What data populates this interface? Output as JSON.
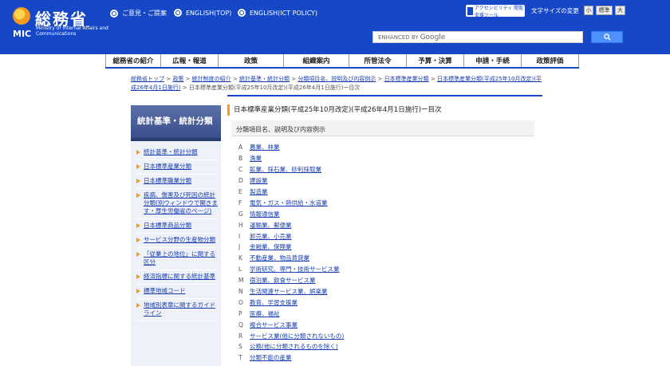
{
  "header": {
    "logo_jp": "総務省",
    "logo_mic": "MIC",
    "logo_en": "Ministry of Internal Affairs and Communications",
    "links": [
      "ご意見・ご提案",
      "ENGLISH(TOP)",
      "ENGLISH(ICT POLICY)"
    ],
    "accessibility": "アクセシビリティ 閲覧支援ツール",
    "font_size_label": "文字サイズの変更",
    "font_size_options": [
      "小",
      "標準",
      "大"
    ],
    "search_prefix": "ENHANCED BY",
    "search_brand": "Google",
    "search_icon": "search-icon"
  },
  "nav": [
    "総務省の紹介",
    "広報・報道",
    "政策",
    "組織案内",
    "所管法令",
    "予算・決算",
    "申請・手続",
    "政策評価"
  ],
  "breadcrumb": {
    "items": [
      "総務省トップ",
      "政策",
      "統計制度の紹介",
      "統計基準・統計分類",
      "分類項目名、説明及び内容例示",
      "日本標準産業分類",
      "日本標準産業分類(平成25年10月改定)(平成26年4月1日施行)"
    ],
    "current": "日本標準産業分類(平成25年10月改定)(平成26年4月1日施行)ー目次"
  },
  "sidebar": {
    "title": "統計基準・統計分類",
    "items": [
      "統計基準・統計分類",
      "日本標準産業分類",
      "日本標準職業分類",
      "疾病、傷害及び死因の統計分類(別ウィンドウで開きます・厚生労働省のページ)",
      "日本標準商品分類",
      "サービス分野の生産物分類",
      "「従業上の地位」に関する区分",
      "経済指標に関する統計基準",
      "標準地域コード",
      "地域別表章に関するガイドライン"
    ]
  },
  "main": {
    "title": "日本標準産業分類(平成25年10月改定)(平成26年4月1日施行)ー目次",
    "subheading": "分類項目名、説明及び内容例示",
    "classes": [
      {
        "code": "A",
        "name": "農業、林業",
        "link": true
      },
      {
        "code": "B",
        "name": "漁業",
        "link": true
      },
      {
        "code": "C",
        "name": "鉱業、採石業、砂利採取業",
        "link": true
      },
      {
        "code": "D",
        "name": "建設業",
        "link": true
      },
      {
        "code": "E",
        "name": "製造業",
        "link": true
      },
      {
        "code": "F",
        "name": "電気・ガス・熱供給・水道業",
        "link": true
      },
      {
        "code": "G",
        "name": "情報通信業",
        "link": true
      },
      {
        "code": "H",
        "name": "運輸業、郵便業",
        "link": true
      },
      {
        "code": "I",
        "name": "卸売業、小売業",
        "link": true
      },
      {
        "code": "J",
        "name": "金融業、保険業",
        "link": true
      },
      {
        "code": "K",
        "name": "不動産業、物品賃貸業",
        "link": true
      },
      {
        "code": "L",
        "name": "学術研究、専門・技術サービス業",
        "link": true
      },
      {
        "code": "M",
        "name": "宿泊業、飲食サービス業",
        "link": true
      },
      {
        "code": "N",
        "name": "生活関連サービス業、娯楽業",
        "link": true
      },
      {
        "code": "O",
        "name": "教育、学習支援業",
        "link": true
      },
      {
        "code": "P",
        "name": "医療、福祉",
        "link": true
      },
      {
        "code": "Q",
        "name": "複合サービス事業",
        "link": true
      },
      {
        "code": "R",
        "name": "サービス業(他に分類されないもの)",
        "link": true
      },
      {
        "code": "S",
        "name": "公務(他に分類されるものを除く)",
        "link": true
      },
      {
        "code": "T",
        "name": "分類不能の産業",
        "link": true
      }
    ]
  },
  "colors": {
    "brand_blue": "#1547c7",
    "accent_orange": "#f49a1c",
    "link": "#1a3fae"
  }
}
